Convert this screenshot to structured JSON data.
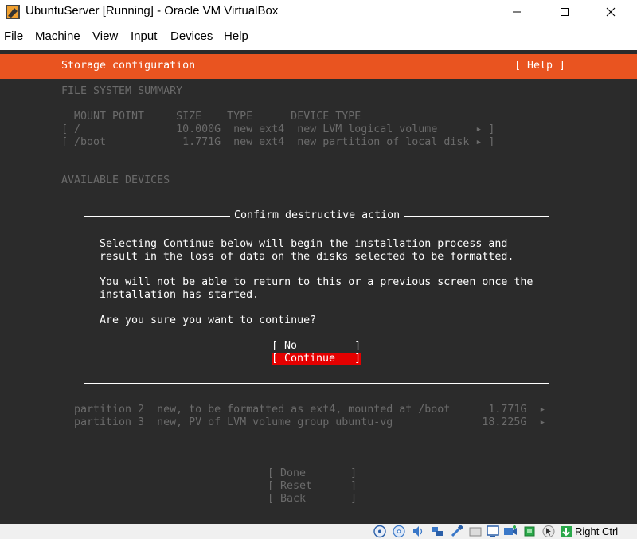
{
  "window": {
    "title": "UbuntuServer [Running] - Oracle VM VirtualBox"
  },
  "menu": [
    "File",
    "Machine",
    "View",
    "Input",
    "Devices",
    "Help"
  ],
  "installer": {
    "header_title": "Storage configuration",
    "help_label": "[ Help ]",
    "fs_summary_heading": "FILE SYSTEM SUMMARY",
    "fs_columns": "MOUNT POINT     SIZE    TYPE      DEVICE TYPE",
    "fs_rows": [
      "[ /               10.000G  new ext4  new LVM logical volume      ▸ ]",
      "[ /boot            1.771G  new ext4  new partition of local disk ▸ ]"
    ],
    "available_heading": "AVAILABLE DEVICES",
    "partitions": [
      "partition 2  new, to be formatted as ext4, mounted at /boot      1.771G  ▸",
      "partition 3  new, PV of LVM volume group ubuntu-vg              18.225G  ▸"
    ],
    "bottom_buttons": [
      "[ Done       ]",
      "[ Reset      ]",
      "[ Back       ]"
    ]
  },
  "dialog": {
    "title": "Confirm destructive action",
    "lines": [
      "Selecting Continue below will begin the installation process and",
      "result in the loss of data on the disks selected to be formatted.",
      "You will not be able to return to this or a previous screen once the",
      "installation has started.",
      "Are you sure you want to continue?"
    ],
    "no_label": "[ No         ]",
    "continue_label": "[ Continue   ]"
  },
  "statusbar": {
    "host_key": "Right Ctrl",
    "icons": [
      "hard-disk-icon",
      "optical-drive-icon",
      "audio-icon",
      "network-icon",
      "usb-icon",
      "shared-folders-icon",
      "display-icon",
      "video-capture-icon",
      "cpu-icon",
      "mouse-integration-icon",
      "keyboard-capture-icon"
    ]
  },
  "colors": {
    "ubuntu_orange": "#e95420",
    "terminal_bg": "#2b2b2b",
    "dim_text": "#6b6b6b",
    "selected_button": "#e40000"
  }
}
